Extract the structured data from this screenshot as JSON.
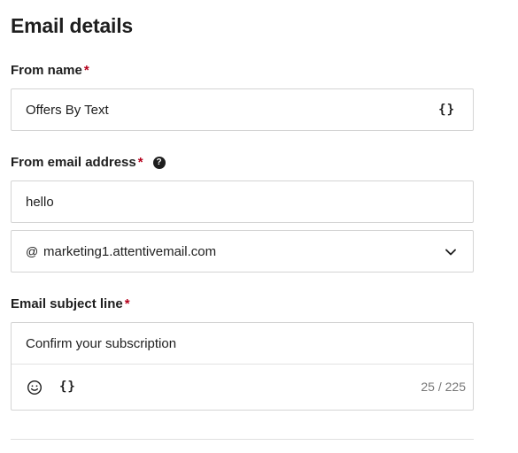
{
  "section": {
    "title": "Email details"
  },
  "from_name": {
    "label": "From name",
    "required_mark": "*",
    "value": "Offers By Text",
    "personalization_glyph": "{}"
  },
  "from_email": {
    "label": "From email address",
    "required_mark": "*",
    "help_glyph": "?",
    "local_part": "hello",
    "at_symbol": "@",
    "domain": "marketing1.attentivemail.com"
  },
  "subject": {
    "label": "Email subject line",
    "required_mark": "*",
    "value": "Confirm your subscription",
    "personalization_glyph": "{}",
    "char_count": "25 / 225"
  },
  "colors": {
    "required": "#b4001c",
    "border": "#d4d4d4",
    "text": "#1e1e1e",
    "muted": "#767676"
  },
  "icons": {
    "help": "question-circle-icon",
    "chevron": "chevron-down-icon",
    "emoji": "smiley-icon",
    "personalization": "braces-icon"
  }
}
